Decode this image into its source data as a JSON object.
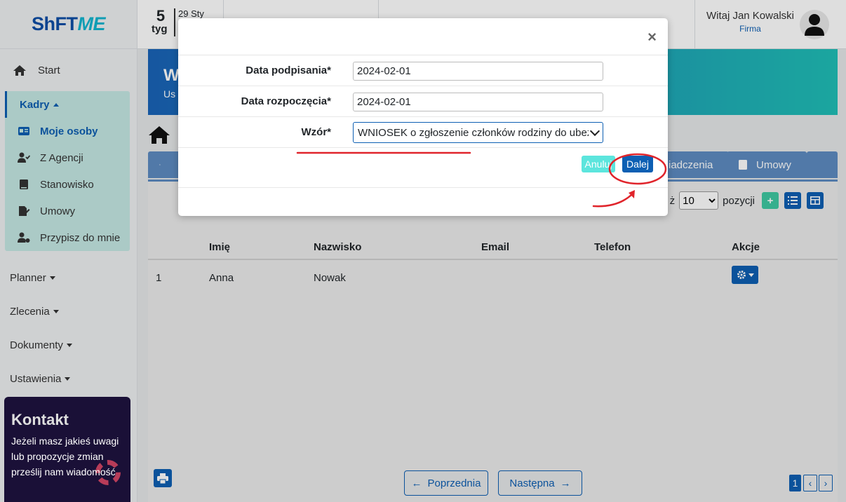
{
  "logo": {
    "part1": "ShFT",
    "part2": "ME"
  },
  "topbar": {
    "week_number": "5",
    "week_label": "tyg",
    "date": "29 Sty",
    "user_greeting": "Witaj Jan Kowalski",
    "user_company": "Firma"
  },
  "sidebar": {
    "start": "Start",
    "kadry": "Kadry",
    "kadry_items": [
      "Moje osoby",
      "Z Agencji",
      "Stanowisko",
      "Umowy",
      "Przypisz do mnie"
    ],
    "menus": [
      "Planner",
      "Zlecenia",
      "Dokumenty",
      "Ustawienia"
    ]
  },
  "contact": {
    "title": "Kontakt",
    "text": "Jeżeli masz jakieś uwagi lub propozycje zmian prześlij nam wiadomość"
  },
  "banner": {
    "title": "W",
    "subtitle": "Us"
  },
  "tabs": [
    "iadczenia",
    "Umowy"
  ],
  "per_page": {
    "suffix_before": "ż",
    "value": "10",
    "suffix": "pozycji"
  },
  "table": {
    "headers": [
      "Imię",
      "Nazwisko",
      "Email",
      "Telefon",
      "Akcje"
    ],
    "rows": [
      {
        "no": "1",
        "first": "Anna",
        "last": "Nowak",
        "email": "",
        "phone": ""
      }
    ]
  },
  "pagination": {
    "prev": "Poprzednia",
    "next": "Następna",
    "page": "1"
  },
  "modal": {
    "close": "×",
    "fields": [
      {
        "label": "Data podpisania*",
        "value": "2024-02-01"
      },
      {
        "label": "Data rozpoczęcia*",
        "value": "2024-02-01"
      }
    ],
    "template_label": "Wzór*",
    "template_value": "WNIOSEK o zgłoszenie członków rodziny do ubezpieczenia",
    "cancel": "Anuluj",
    "next": "Dalej"
  },
  "colors": {
    "primary": "#0d5fb3",
    "teal": "#20bfb7",
    "annotation": "#e0242b"
  }
}
